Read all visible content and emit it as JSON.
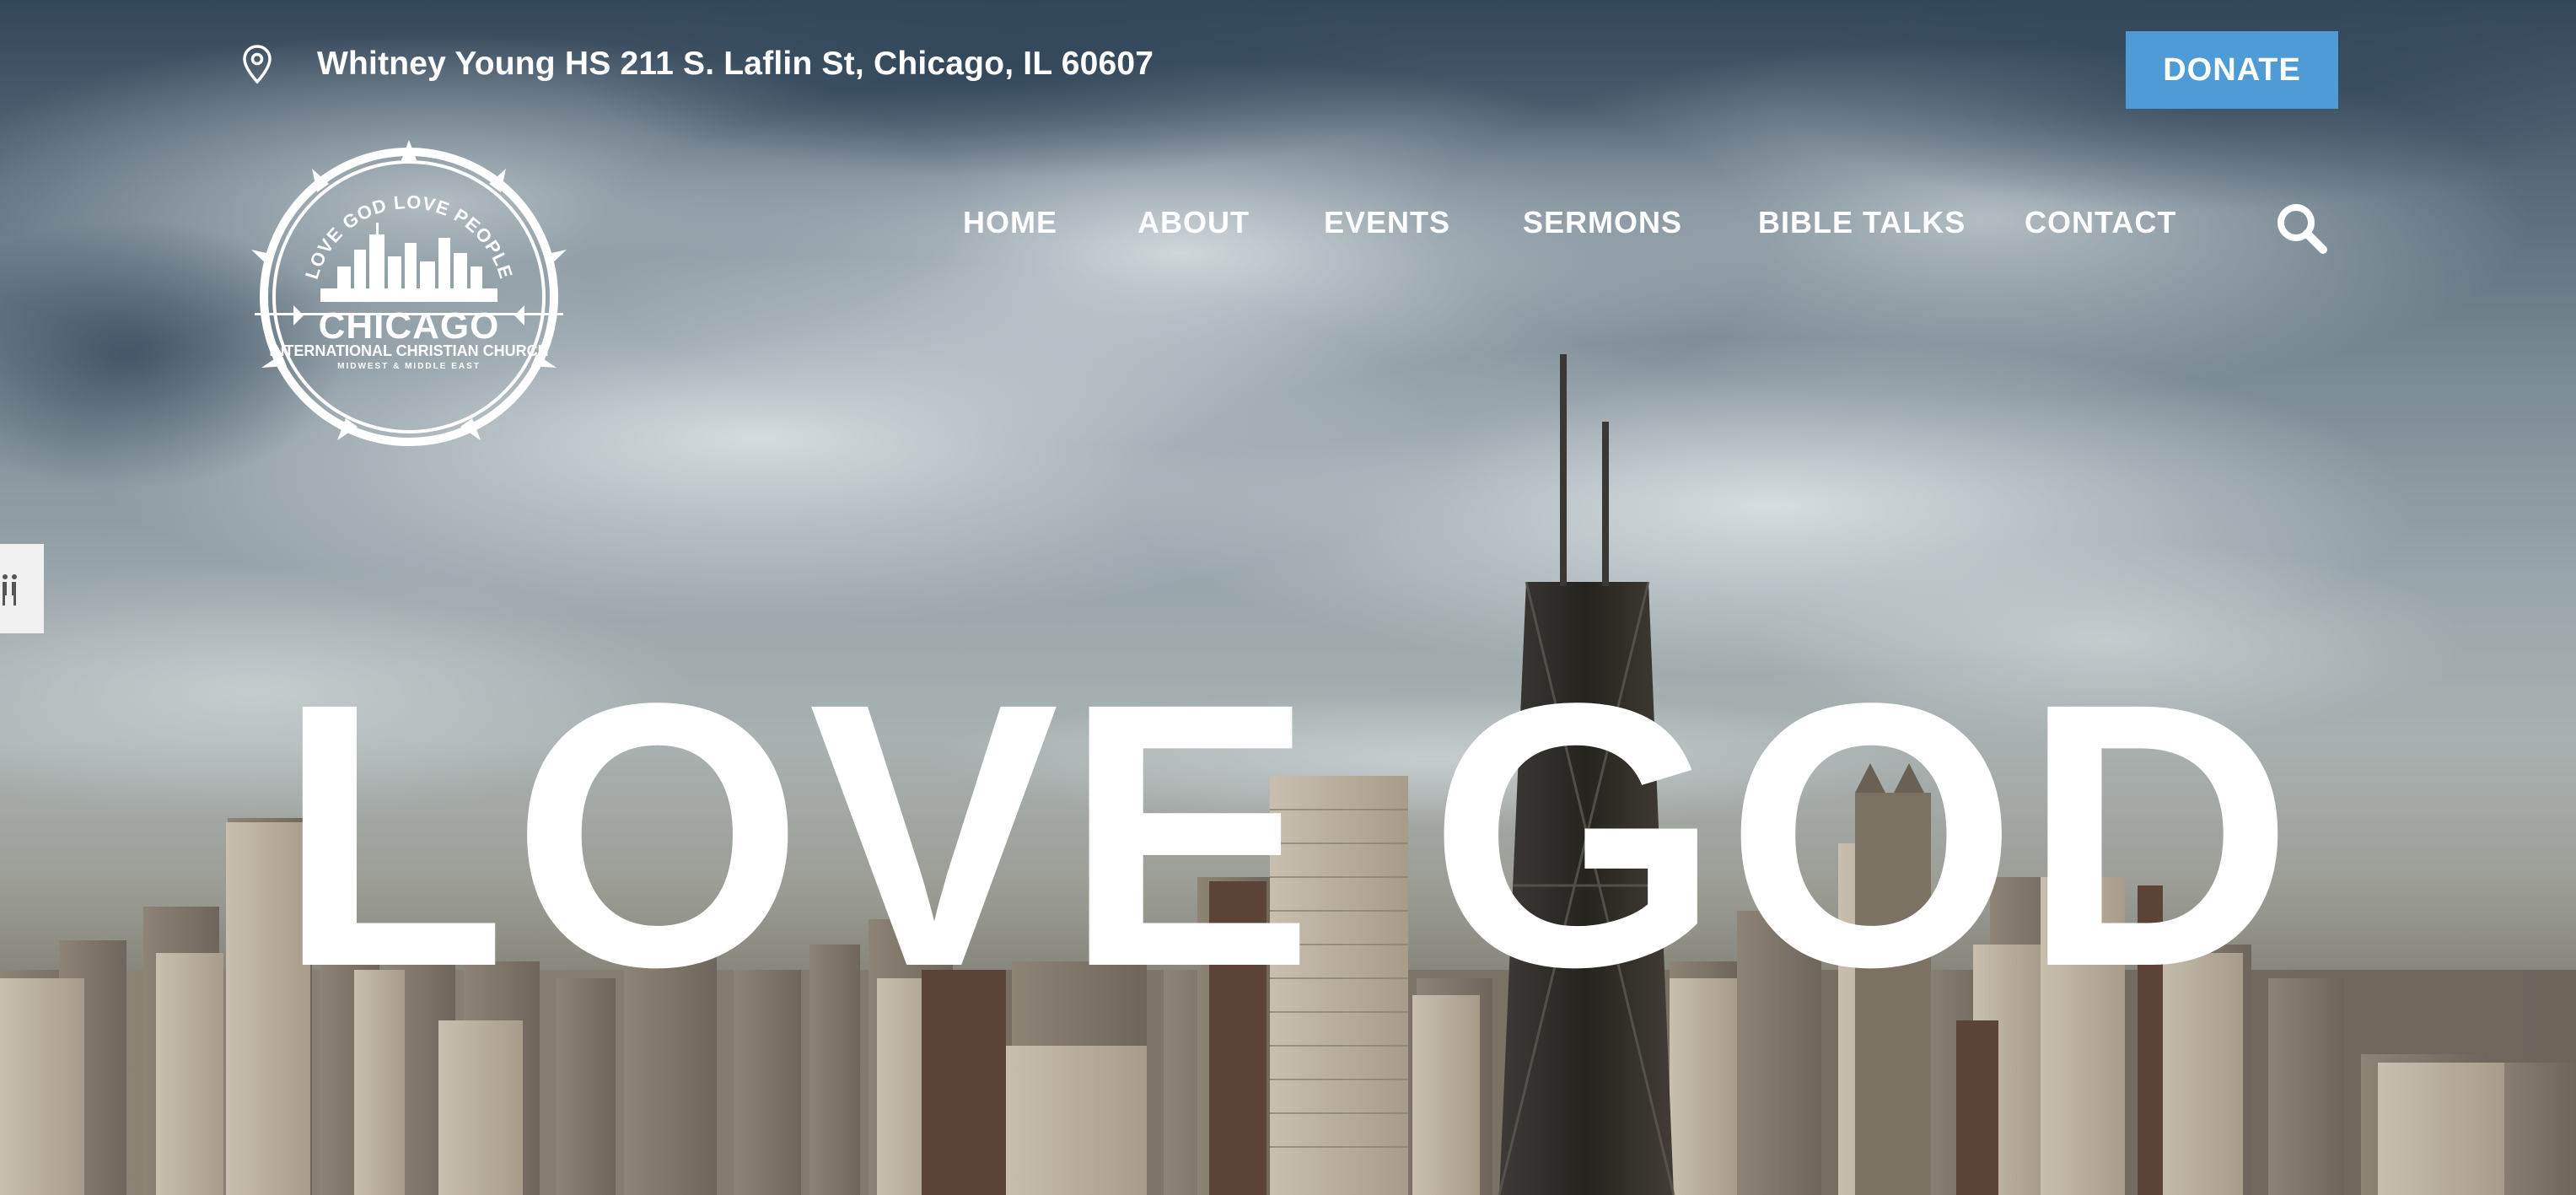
{
  "topbar": {
    "address": "Whitney Young HS 211 S. Laflin St, Chicago, IL 60607",
    "donate_label": "DONATE"
  },
  "logo": {
    "motto": "LOVE GOD LOVE PEOPLE",
    "city": "CHICAGO",
    "church": "INTERNATIONAL CHRISTIAN CHURCH",
    "region": "MIDWEST & MIDDLE EAST"
  },
  "nav": {
    "items": [
      "HOME",
      "ABOUT",
      "EVENTS",
      "SERMONS",
      "BIBLE TALKS",
      "CONTACT"
    ]
  },
  "hero": {
    "headline": "LOVE GOD"
  },
  "icons": {
    "location": "location-pin-icon",
    "search": "search-icon",
    "side_tab": "accessibility-icon"
  },
  "colors": {
    "donate_bg": "#4e9bd5",
    "text": "#ffffff",
    "side_tab_bg": "#f1f1f1"
  }
}
